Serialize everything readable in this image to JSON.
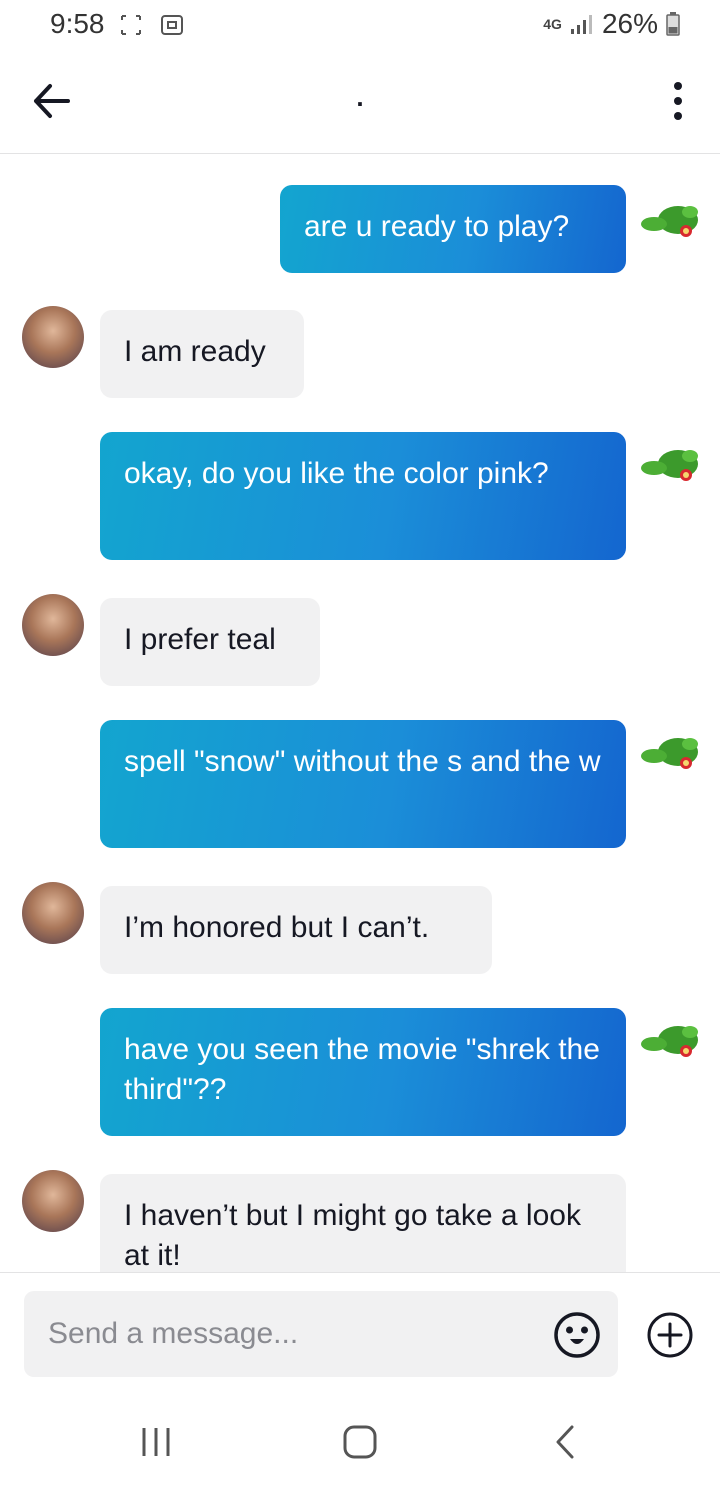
{
  "status_bar": {
    "time": "9:58",
    "network": "4G",
    "battery": "26%"
  },
  "header": {
    "title": ".",
    "back_icon": "arrow-left-icon",
    "menu_icon": "more-vertical-icon"
  },
  "messages": [
    {
      "from": "me",
      "text": "are u ready to play?"
    },
    {
      "from": "them",
      "text": "I am ready"
    },
    {
      "from": "me",
      "text": "okay, do you like the color pink?"
    },
    {
      "from": "them",
      "text": "I prefer teal"
    },
    {
      "from": "me",
      "text": "spell \"snow\" without the s and the w"
    },
    {
      "from": "them",
      "text": "I’m honored but I can’t."
    },
    {
      "from": "me",
      "text": "have you seen the movie \"shrek the third\"??"
    },
    {
      "from": "them",
      "text": "I haven’t but I might go take a look at it!"
    }
  ],
  "composer": {
    "placeholder": "Send a message...",
    "emoji_icon": "smiley-icon",
    "add_icon": "plus-circle-icon"
  },
  "colors": {
    "sent_bubble_start": "#13a5cf",
    "sent_bubble_end": "#1466cf",
    "received_bubble": "#f1f1f2"
  }
}
